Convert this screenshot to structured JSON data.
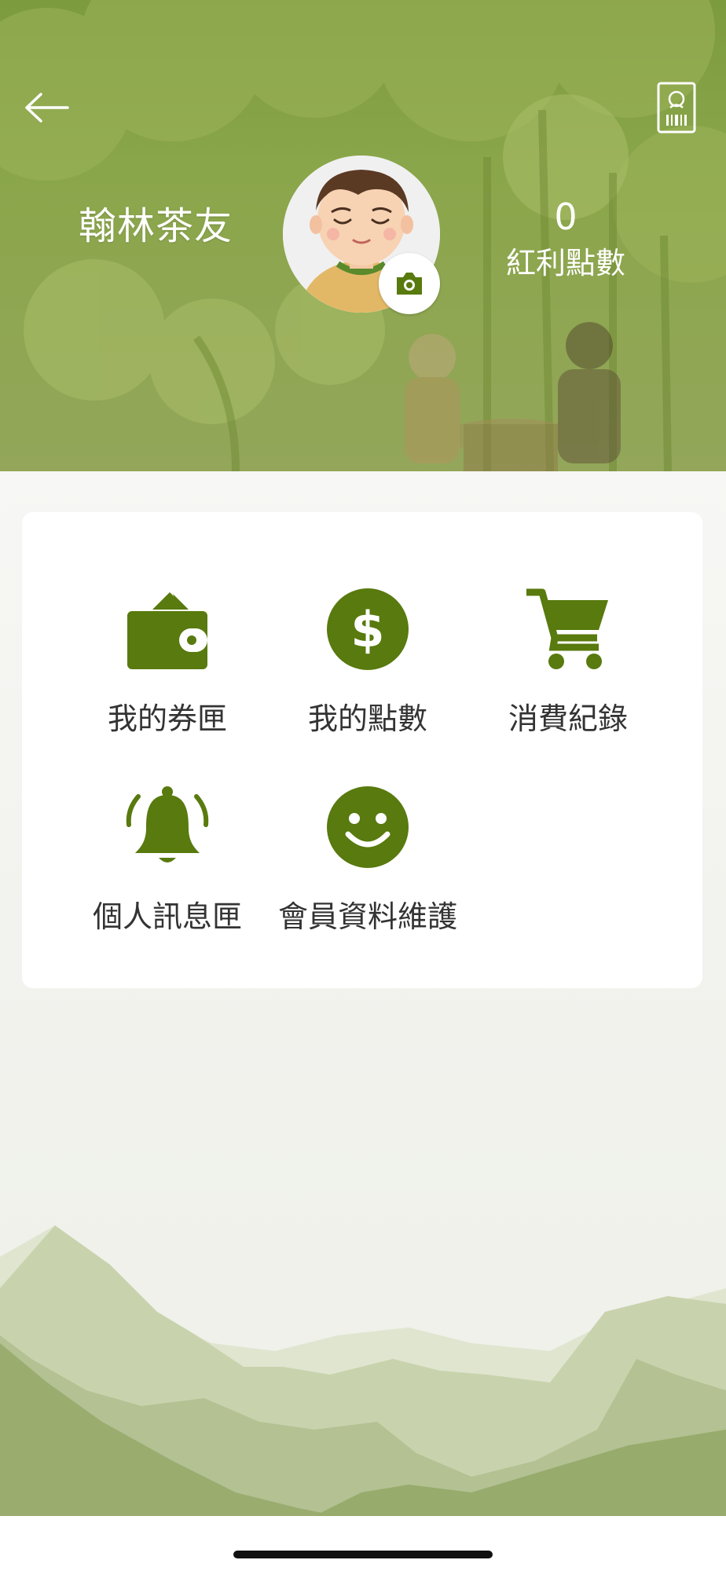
{
  "header": {
    "user_name": "翰林茶友",
    "points_value": "0",
    "points_label": "紅利點數",
    "back_icon": "arrow-left-icon",
    "member_card_icon": "member-card-barcode-icon",
    "camera_icon": "camera-icon"
  },
  "menu": {
    "items": [
      {
        "label": "我的券匣",
        "icon": "wallet-icon"
      },
      {
        "label": "我的點數",
        "icon": "dollar-coin-icon"
      },
      {
        "label": "消費紀錄",
        "icon": "shopping-cart-icon"
      },
      {
        "label": "個人訊息匣",
        "icon": "bell-icon"
      },
      {
        "label": "會員資料維護",
        "icon": "smile-icon"
      }
    ]
  },
  "colors": {
    "accent": "#587a0e",
    "header_green": "#8aa64a",
    "mountain_light": "#c6d2a8",
    "mountain_dark": "#97ab6c"
  }
}
